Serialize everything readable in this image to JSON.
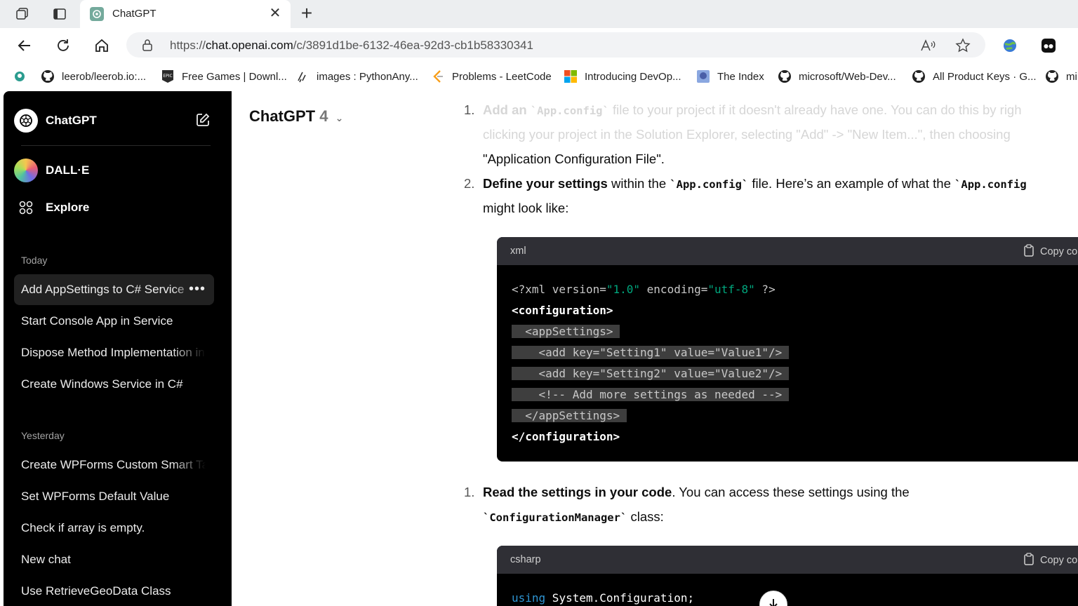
{
  "browser": {
    "tab_title": "ChatGPT",
    "url_prefix": "https://",
    "url_host": "chat.openai.com",
    "url_path": "/c/3891d1be-6132-46ea-92d3-cb1b58330341",
    "bookmarks": [
      {
        "label": "leerob/leerob.io:...",
        "icon": "github-icon"
      },
      {
        "label": "Free Games | Downl...",
        "icon": "epic-games-icon"
      },
      {
        "label": "images : PythonAny...",
        "icon": "pythonanywhere-icon"
      },
      {
        "label": "Problems - LeetCode",
        "icon": "leetcode-icon"
      },
      {
        "label": "Introducing DevOp...",
        "icon": "microsoft-icon"
      },
      {
        "label": "The Index",
        "icon": "anime-icon"
      },
      {
        "label": "microsoft/Web-Dev...",
        "icon": "github-icon"
      },
      {
        "label": "All Product Keys · G...",
        "icon": "github-icon"
      },
      {
        "label": "mi",
        "icon": "github-icon"
      }
    ]
  },
  "sidebar": {
    "app_name": "ChatGPT",
    "gpts": [
      {
        "label": "DALL·E"
      },
      {
        "label": "Explore"
      }
    ],
    "sections": [
      {
        "label": "Today",
        "items": [
          {
            "label": "Add AppSettings to C# Service",
            "active": true
          },
          {
            "label": "Start Console App in Service"
          },
          {
            "label": "Dispose Method Implementation in"
          },
          {
            "label": "Create Windows Service in C#"
          }
        ]
      },
      {
        "label": "Yesterday",
        "items": [
          {
            "label": "Create WPForms Custom Smart Tag"
          },
          {
            "label": "Set WPForms Default Value"
          },
          {
            "label": "Check if array is empty."
          },
          {
            "label": "New chat"
          },
          {
            "label": "Use RetrieveGeoData Class"
          }
        ]
      }
    ]
  },
  "main": {
    "model_name": "ChatGPT",
    "model_version": "4",
    "step1": {
      "num": "1.",
      "line1_pre": "Add an ",
      "line1_code": "`App.config`",
      "line1_post": " file to your project if it doesn't already have one. You can do this by righ",
      "line2": "clicking your project in the Solution Explorer, selecting \"Add\" -> \"New Item...\", then choosing",
      "line3": "\"Application Configuration File\"."
    },
    "step2": {
      "num": "2.",
      "bold": "Define your settings",
      "text1": " within the ",
      "code1": "`App.config`",
      "text2": " file. Here’s an example of what the ",
      "code2": "`App.config",
      "line2": "might look like:"
    },
    "code1": {
      "lang": "xml",
      "copy_label": "Copy co"
    },
    "step3": {
      "num": "1.",
      "bold": "Read the settings in your code",
      "text1": ". You can access these settings using the",
      "code": "`ConfigurationManager`",
      "text2": " class:"
    },
    "code2": {
      "lang": "csharp",
      "copy_label": "Copy co"
    }
  }
}
